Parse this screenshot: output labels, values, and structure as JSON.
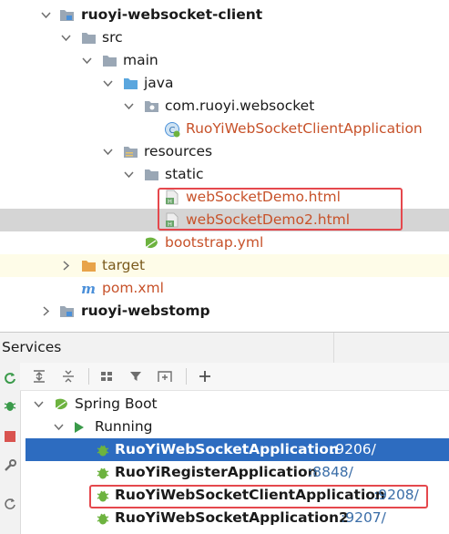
{
  "project_tree": {
    "module_client": "ruoyi-websocket-client",
    "src": "src",
    "main": "main",
    "java": "java",
    "package": "com.ruoyi.websocket",
    "app_class": "RuoYiWebSocketClientApplication",
    "resources": "resources",
    "static": "static",
    "file_demo": "webSocketDemo.html",
    "file_demo2": "webSocketDemo2.html",
    "bootstrap": "bootstrap.yml",
    "target": "target",
    "pom": "pom.xml",
    "module_webstomp": "ruoyi-webstomp"
  },
  "services": {
    "title": "Services",
    "spring_boot": "Spring Boot",
    "running": "Running",
    "apps": [
      {
        "name": "RuoYiWebSocketApplication",
        "port": ":9206/"
      },
      {
        "name": "RuoYiRegisterApplication",
        "port": ":8848/"
      },
      {
        "name": "RuoYiWebSocketClientApplication",
        "port": ":9208/"
      },
      {
        "name": "RuoYiWebSocketApplication2",
        "port": ":9207/"
      }
    ]
  },
  "colors": {
    "selection": "#2d6cc0",
    "highlight_box": "#e5484d",
    "spring_green": "#6db33f"
  },
  "icons": {
    "module": "module-folder-icon",
    "folder": "folder-icon",
    "java_folder": "java-source-folder-icon",
    "package": "package-icon",
    "spring_class": "spring-boot-class-icon",
    "resources_folder": "resources-folder-icon",
    "html_file": "html-file-icon",
    "yml_file": "spring-yml-icon",
    "target_folder": "target-folder-icon",
    "maven": "maven-icon",
    "run_config": "run-config-icon"
  }
}
